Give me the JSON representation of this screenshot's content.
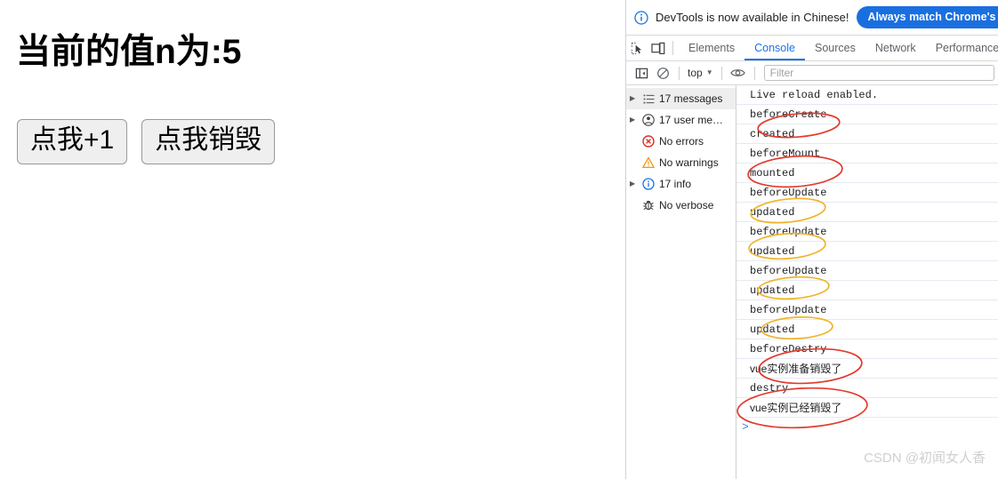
{
  "page": {
    "heading": "当前的值n为:5",
    "buttons": [
      {
        "label": "点我+1",
        "name": "increment-button"
      },
      {
        "label": "点我销毁",
        "name": "destroy-button"
      }
    ]
  },
  "devtools": {
    "banner": {
      "icon": "info-circle-icon",
      "text": "DevTools is now available in Chinese!",
      "button_label": "Always match Chrome's language",
      "button_color": "#1a6fe0"
    },
    "tabs": {
      "inspect_icon": "inspect-element-icon",
      "device_icon": "device-toolbar-icon",
      "items": [
        {
          "label": "Elements",
          "active": false
        },
        {
          "label": "Console",
          "active": true
        },
        {
          "label": "Sources",
          "active": false
        },
        {
          "label": "Network",
          "active": false
        },
        {
          "label": "Performance",
          "active": false
        }
      ],
      "active_color": "#1a73e8"
    },
    "console_toolbar": {
      "sidebar_toggle_icon": "console-sidebar-toggle-icon",
      "clear_icon": "clear-console-icon",
      "context": "top",
      "caret": "▼",
      "eye_icon": "live-expression-eye-icon",
      "filter_placeholder": "Filter",
      "filter_value": ""
    },
    "sidebar": {
      "items": [
        {
          "label": "17 messages",
          "icon": "list-icon",
          "expandable": true,
          "selected": true
        },
        {
          "label": "17 user me…",
          "icon": "user-message-icon",
          "expandable": true,
          "selected": false
        },
        {
          "label": "No errors",
          "icon": "error-icon",
          "expandable": false,
          "selected": false
        },
        {
          "label": "No warnings",
          "icon": "warning-icon",
          "expandable": false,
          "selected": false
        },
        {
          "label": "17 info",
          "icon": "info-icon",
          "expandable": true,
          "selected": false
        },
        {
          "label": "No verbose",
          "icon": "verbose-bug-icon",
          "expandable": false,
          "selected": false
        }
      ]
    },
    "messages": [
      {
        "text": "Live reload enabled.",
        "cn": false
      },
      {
        "text": "beforeCreate",
        "cn": false
      },
      {
        "text": "created",
        "cn": false
      },
      {
        "text": "beforeMount",
        "cn": false
      },
      {
        "text": "mounted",
        "cn": false
      },
      {
        "text": "beforeUpdate",
        "cn": false
      },
      {
        "text": "updated",
        "cn": false
      },
      {
        "text": "beforeUpdate",
        "cn": false
      },
      {
        "text": "updated",
        "cn": false
      },
      {
        "text": "beforeUpdate",
        "cn": false
      },
      {
        "text": "updated",
        "cn": false
      },
      {
        "text": "beforeUpdate",
        "cn": false
      },
      {
        "text": "updated",
        "cn": false
      },
      {
        "text": "beforeDestry",
        "cn": false
      },
      {
        "text": "vue实例准备销毁了",
        "cn": true
      },
      {
        "text": "destry",
        "cn": false
      },
      {
        "text": "vue实例已经销毁了",
        "cn": true
      }
    ],
    "prompt": ">",
    "annotation_colors": {
      "red": "#e23b2e",
      "yellow": "#f0b429"
    }
  },
  "watermark": "CSDN @初闻女人香"
}
